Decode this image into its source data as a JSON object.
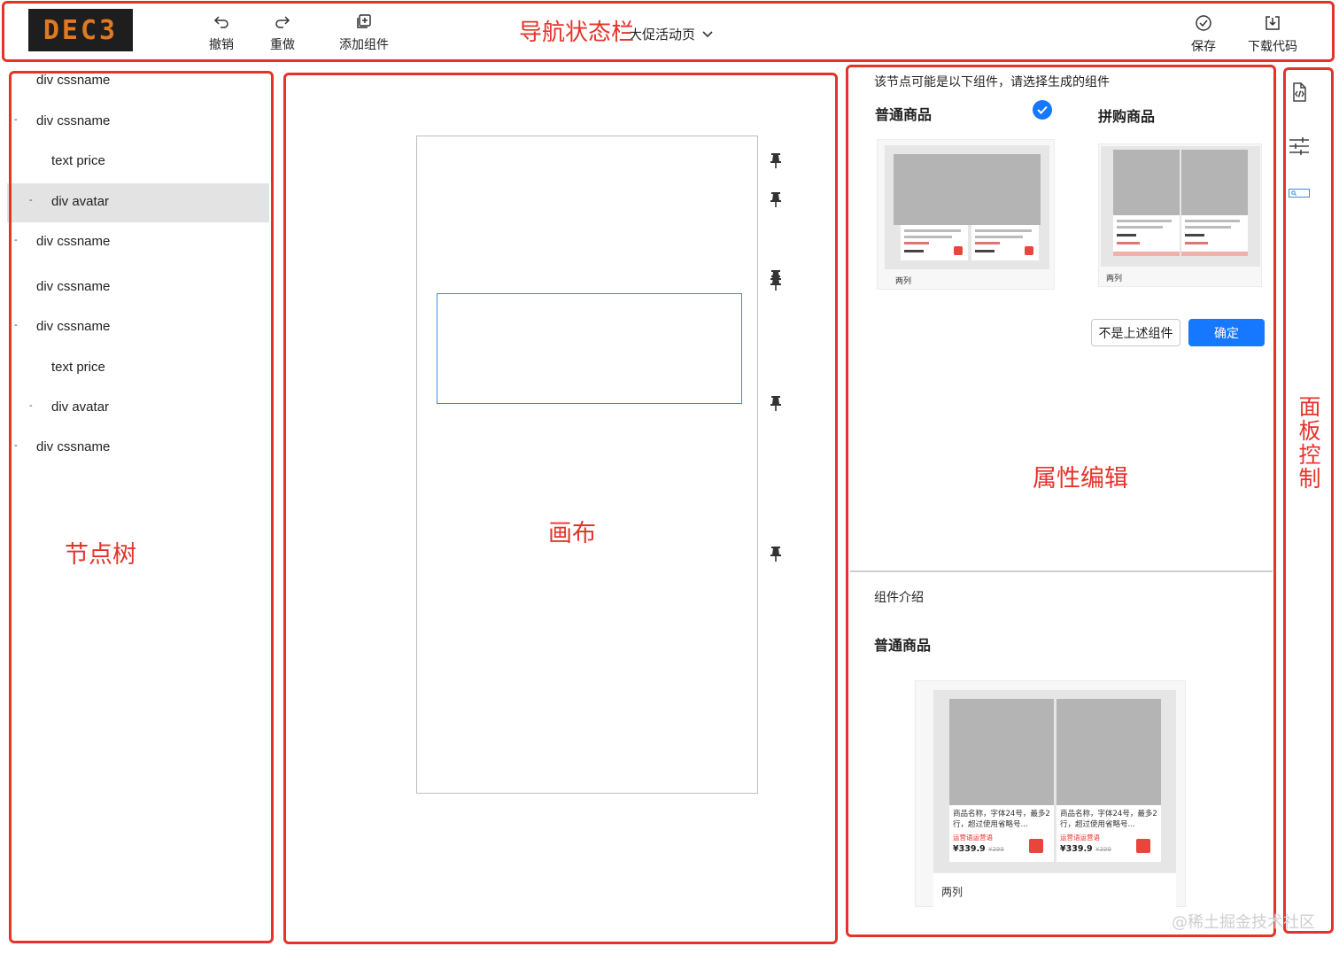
{
  "header": {
    "logo_text": "DEC3",
    "toolbar": [
      {
        "label": "撤销",
        "icon": "undo-icon"
      },
      {
        "label": "重做",
        "icon": "redo-icon"
      },
      {
        "label": "添加组件",
        "icon": "add-component-icon"
      }
    ],
    "page_select": "大促活动页",
    "actions": [
      {
        "label": "保存",
        "icon": "check-circle-icon"
      },
      {
        "label": "下载代码",
        "icon": "download-icon"
      }
    ]
  },
  "node_tree": [
    {
      "label": "div cssname",
      "dash": false,
      "indent": 0,
      "selected": false
    },
    {
      "label": "div cssname",
      "dash": true,
      "indent": 0,
      "selected": false
    },
    {
      "label": "text price",
      "dash": false,
      "indent": 1,
      "selected": false
    },
    {
      "label": "div avatar",
      "dash": true,
      "indent": 1,
      "selected": true
    },
    {
      "label": "div cssname",
      "dash": true,
      "indent": 0,
      "selected": false
    },
    {
      "label": "div cssname",
      "dash": false,
      "indent": 0,
      "selected": false
    },
    {
      "label": "div cssname",
      "dash": true,
      "indent": 0,
      "selected": false
    },
    {
      "label": "text price",
      "dash": false,
      "indent": 1,
      "selected": false
    },
    {
      "label": "div avatar",
      "dash": true,
      "indent": 1,
      "selected": false
    },
    {
      "label": "div cssname",
      "dash": true,
      "indent": 0,
      "selected": false
    }
  ],
  "props": {
    "hint": "该节点可能是以下组件，请选择生成的组件",
    "options": [
      {
        "title": "普通商品",
        "caption": "两列",
        "selected": true
      },
      {
        "title": "拼购商品",
        "caption": "两列",
        "selected": false
      }
    ],
    "not_above_label": "不是上述组件",
    "confirm_label": "确定",
    "intro_label": "组件介绍",
    "intro_title": "普通商品",
    "intro_caption": "两列",
    "product_text_1": "商品名称，字体24号，最多2",
    "product_text_2": "行，超过使用省略号...",
    "product_sub": "运营语运营语",
    "price": "¥339.9",
    "old_price": "¥399"
  },
  "annotations": {
    "nav": "导航状态栏",
    "tree": "节点树",
    "canvas": "画布",
    "props": "属性编辑",
    "panel": "面板控制"
  },
  "watermark": "@稀土掘金技术社区",
  "colors": {
    "annotation_red": "#e5332a",
    "primary_blue": "#1677ff",
    "selection_blue": "#3d8bd8",
    "tree_selected_bg": "#e3e3e3"
  }
}
